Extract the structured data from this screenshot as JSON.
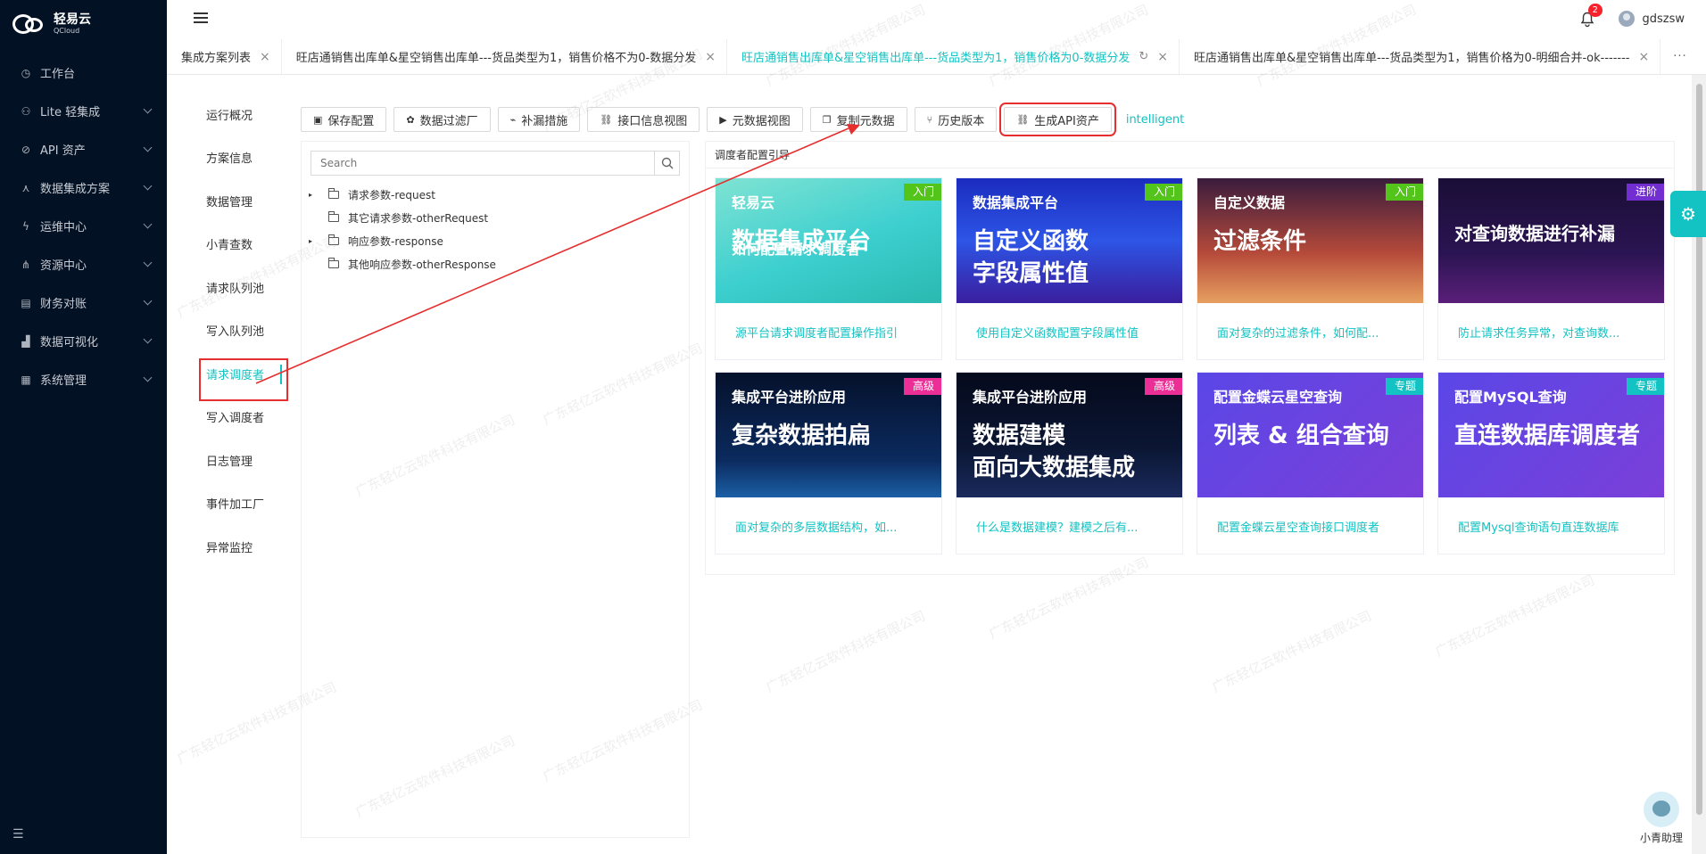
{
  "app": {
    "logo_cn": "轻易云",
    "logo_en": "QCloud"
  },
  "sidebar": {
    "items": [
      {
        "label": "工作台",
        "icon": "clock-icon",
        "has_children": false
      },
      {
        "label": "Lite 轻集成",
        "icon": "lite-icon",
        "has_children": true
      },
      {
        "label": "API 资产",
        "icon": "api-icon",
        "has_children": true
      },
      {
        "label": "数据集成方案",
        "icon": "integration-icon",
        "has_children": true
      },
      {
        "label": "运维中心",
        "icon": "bolt-icon",
        "has_children": true
      },
      {
        "label": "资源中心",
        "icon": "resource-icon",
        "has_children": true
      },
      {
        "label": "财务对账",
        "icon": "finance-icon",
        "has_children": true
      },
      {
        "label": "数据可视化",
        "icon": "chart-icon",
        "has_children": true
      },
      {
        "label": "系统管理",
        "icon": "system-icon",
        "has_children": true
      }
    ]
  },
  "header": {
    "notification_count": "2",
    "username": "gdszsw"
  },
  "tabs": [
    {
      "label": "集成方案列表",
      "active": false
    },
    {
      "label": "旺店通销售出库单&星空销售出库单---货品类型为1，销售价格不为0-数据分发",
      "active": false
    },
    {
      "label": "旺店通销售出库单&星空销售出库单---货品类型为1，销售价格为0-数据分发",
      "active": true
    },
    {
      "label": "旺店通销售出库单&星空销售出库单---货品类型为1，销售价格为0-明细合并-ok-------",
      "active": false
    }
  ],
  "tabs_more": "···",
  "subnav": [
    {
      "label": "运行概况",
      "active": false
    },
    {
      "label": "方案信息",
      "active": false
    },
    {
      "label": "数据管理",
      "active": false
    },
    {
      "label": "小青查数",
      "active": false
    },
    {
      "label": "请求队列池",
      "active": false
    },
    {
      "label": "写入队列池",
      "active": false
    },
    {
      "label": "请求调度者",
      "active": true
    },
    {
      "label": "写入调度者",
      "active": false
    },
    {
      "label": "日志管理",
      "active": false
    },
    {
      "label": "事件加工厂",
      "active": false
    },
    {
      "label": "异常监控",
      "active": false
    }
  ],
  "toolbar": {
    "buttons": [
      {
        "label": "保存配置",
        "icon": "save-icon"
      },
      {
        "label": "数据过滤厂",
        "icon": "gear-icon"
      },
      {
        "label": "补漏措施",
        "icon": "patch-icon"
      },
      {
        "label": "接口信息视图",
        "icon": "link-icon"
      },
      {
        "label": "元数据视图",
        "icon": "terminal-icon"
      },
      {
        "label": "复制元数据",
        "icon": "copy-icon"
      },
      {
        "label": "历史版本",
        "icon": "branch-icon"
      },
      {
        "label": "生成API资产",
        "icon": "link-icon"
      }
    ],
    "intelligent": "intelligent"
  },
  "tree": {
    "search_placeholder": "Search",
    "nodes": [
      {
        "label": "请求参数-request",
        "expandable": true
      },
      {
        "label": "其它请求参数-otherRequest",
        "expandable": false
      },
      {
        "label": "响应参数-response",
        "expandable": true
      },
      {
        "label": "其他响应参数-otherResponse",
        "expandable": false
      }
    ]
  },
  "guide": {
    "title": "调度者配置引导",
    "cards": [
      {
        "tag": "入门",
        "tag_color": "#52c41a",
        "caption": "源平台请求调度者配置操作指引",
        "img_lines": [
          "轻易云",
          "数据集成平台",
          "如何配置请求调度者"
        ],
        "bg": "linear-gradient(160deg,#7fe3d3 0%,#3ccfcf 55%,#2bb9b0 100%)"
      },
      {
        "tag": "入门",
        "tag_color": "#52c41a",
        "caption": "使用自定义函数配置字段属性值",
        "img_lines": [
          "数据集成平台",
          "自定义函数",
          "字段属性值"
        ],
        "bg": "linear-gradient(180deg,#1b2cbf 0%,#2d55e6 50%,#3a1e9e 100%)"
      },
      {
        "tag": "入门",
        "tag_color": "#52c41a",
        "caption": "面对复杂的过滤条件，如何配...",
        "img_lines": [
          "自定义数据",
          "过滤条件"
        ],
        "bg": "linear-gradient(180deg,#3a1c3d 0%,#b54a3a 60%,#e7a060 100%)"
      },
      {
        "tag": "进阶",
        "tag_color": "#722ed1",
        "caption": "防止请求任务异常，对查询数...",
        "img_lines": [
          "对查询数据进行补漏"
        ],
        "bg": "linear-gradient(180deg,#1a0e36 0%,#2b1452 60%,#5a1f7a 100%)"
      },
      {
        "tag": "高级",
        "tag_color": "#eb2f96",
        "caption": "面对复杂的多层数据结构，如...",
        "img_lines": [
          "集成平台进阶应用",
          "复杂数据拍扁"
        ],
        "bg": "linear-gradient(180deg,#05112b 0%,#0b2a5e 70%,#1b5fa5 100%)"
      },
      {
        "tag": "高级",
        "tag_color": "#eb2f96",
        "caption": "什么是数据建模？建模之后有...",
        "img_lines": [
          "集成平台进阶应用",
          "数据建模",
          "面向大数据集成"
        ],
        "bg": "linear-gradient(180deg,#050a1c 0%,#0b1633 60%,#1a2a5c 100%)"
      },
      {
        "tag": "专题",
        "tag_color": "#13c2c2",
        "caption": "配置金蝶云星空查询接口调度者",
        "img_lines": [
          "配置金蝶云星空查询",
          "列表 & 组合查询"
        ],
        "bg": "linear-gradient(135deg,#5a47e6 0%,#7b3fd9 100%)"
      },
      {
        "tag": "专题",
        "tag_color": "#13c2c2",
        "caption": "配置Mysql查询语句直连数据库",
        "img_lines": [
          "配置MySQL查询",
          "直连数据库调度者"
        ],
        "bg": "linear-gradient(135deg,#5a47e6 0%,#7b3fd9 100%)"
      }
    ]
  },
  "assistant": {
    "label": "小青助理"
  },
  "watermark": "广东轻亿云软件科技有限公司"
}
